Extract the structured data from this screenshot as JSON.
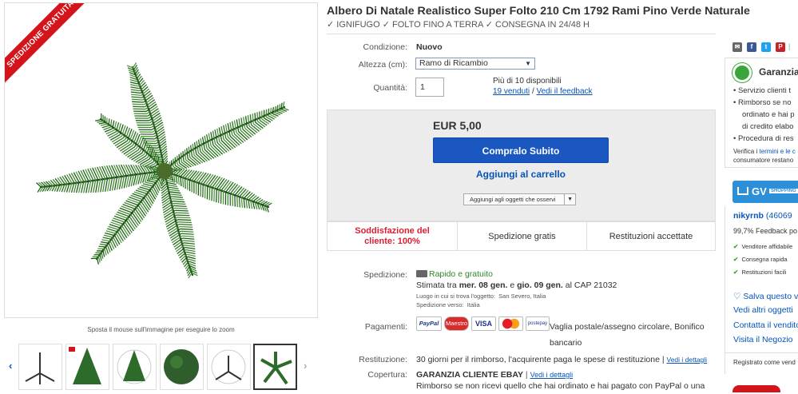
{
  "gallery": {
    "ribbon": "SPEDIZIONE GRATUITA",
    "zoom_hint": "Sposta il mouse sull'immagine per eseguire lo zoom",
    "thumb_count": 6,
    "selected_thumb": 6
  },
  "item": {
    "title": "Albero Di Natale Realistico Super Folto 210 Cm 1792 Rami Pino Verde Naturale",
    "subtitle": "✓ IGNIFUGO ✓ FOLTO FINO A TERRA ✓ CONSEGNA IN 24/48 H"
  },
  "specs": {
    "condition_label": "Condizione:",
    "condition_value": "Nuovo",
    "height_label": "Altezza (cm):",
    "height_value": "Ramo di Ricambio",
    "quantity_label": "Quantità:",
    "quantity_value": "1",
    "availability": "Più di 10 disponibili",
    "sold_link": "19 venduti",
    "separator": "/",
    "feedback_link": "Vedi il feedback"
  },
  "buy": {
    "price": "EUR 5,00",
    "buy_now": "Compralo Subito",
    "add_to_cart": "Aggiungi al carrello",
    "watch": "Aggiungi agli oggetti che osservi",
    "caret": "▼"
  },
  "trust": {
    "satisfaction": "Soddisfazione del cliente: 100%",
    "shipping": "Spedizione gratis",
    "returns": "Restituzioni accettate"
  },
  "shipping": {
    "label": "Spedizione:",
    "title": "Rapido e gratuito",
    "estimate_pre": "Stimata tra",
    "date1": "mer. 08 gen.",
    "and": "e",
    "date2": "gio. 09 gen.",
    "to_cap": "al CAP 21032",
    "location_label": "Luogo in cui si trova l'oggetto:",
    "location_value": "San Severo, Italia",
    "ship_to_label": "Spedizione verso:",
    "ship_to_value": "Italia"
  },
  "payments": {
    "label": "Pagamenti:",
    "methods": [
      "PayPal",
      "Maestro",
      "VISA",
      "MC",
      "postepay"
    ],
    "text": "Vaglia postale/assegno circolare, Bonifico bancario"
  },
  "returns": {
    "label": "Restituzione:",
    "text": "30 giorni per il rimborso, l'acquirente paga le spese di restituzione |",
    "link": "Vedi i dettagli"
  },
  "coverage": {
    "label": "Copertura:",
    "title": "GARANZIA CLIENTE EBAY",
    "link": "Vedi i dettagli",
    "text": "Rimborso se non ricevi quello che hai ordinato e hai pagato con PayPal o una"
  },
  "right": {
    "guarantee_title": "Garanzia",
    "bullets": [
      "Servizio clienti t",
      "Rimborso se no",
      "ordinato e hai p",
      "di credito elabo",
      "Procedura di res"
    ],
    "verify_pre": "Verifica i",
    "verify_link": "termini e le c",
    "verify_post": "consumatore restano",
    "gv_text": "GV",
    "gv_small": "SHOPPING",
    "seller_name": "nikyrnb",
    "seller_score": "(46069",
    "feedback": "99,7% Feedback po",
    "badges": [
      "Venditore affidabile",
      "Consegna rapida",
      "Restituzioni facili"
    ],
    "save_seller": "Salva questo v",
    "other_items": "Vedi altri oggetti",
    "contact": "Contatta il venditore",
    "store": "Visita il Negozio",
    "registered": "Registrato come vend"
  },
  "colors": {
    "link": "#0654ba",
    "buy_button": "#1a57c0",
    "ribbon": "#d3151b",
    "satisfaction": "#dd1e31",
    "shipping_green": "#2b8a2b"
  }
}
